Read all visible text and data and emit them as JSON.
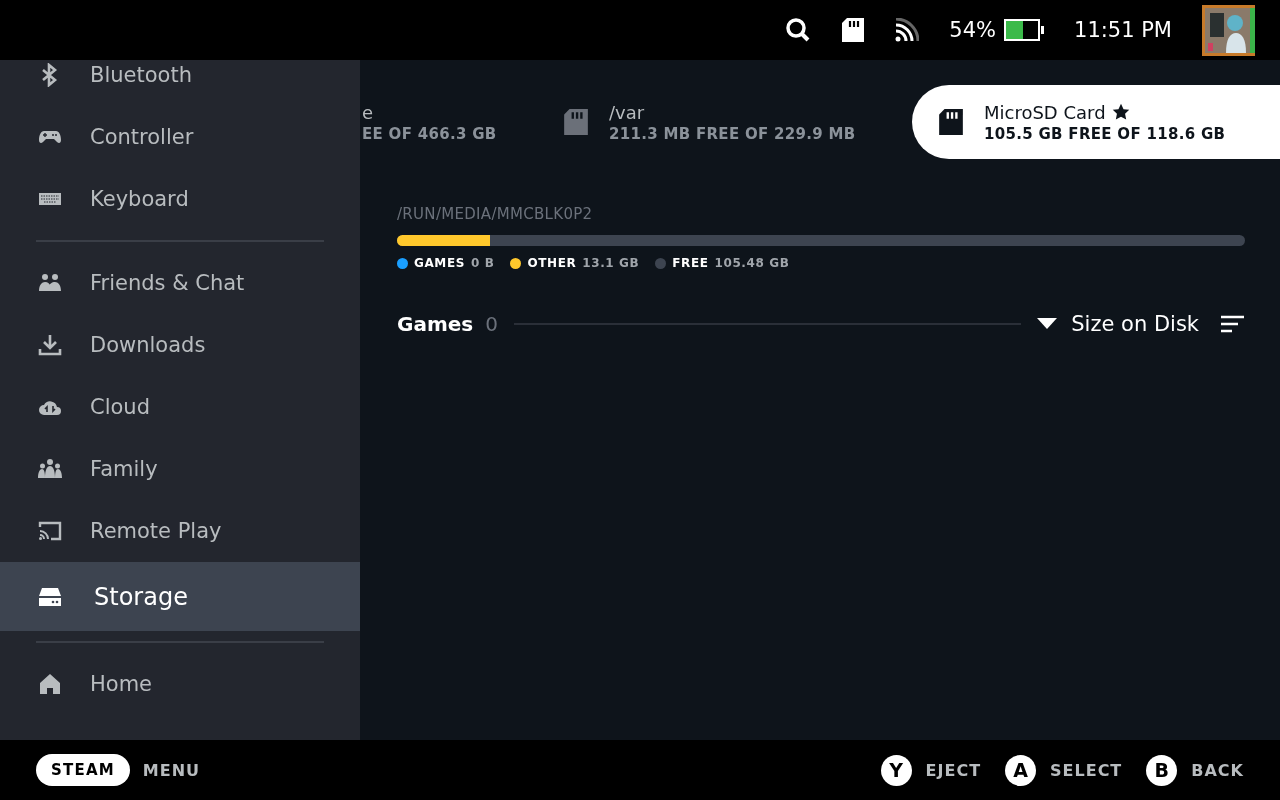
{
  "status_bar": {
    "battery": {
      "text": "54%",
      "level": 0.54
    },
    "time": "11:51 PM"
  },
  "sidebar": {
    "items": [
      {
        "kind": "item",
        "label": "Bluetooth",
        "selected": false
      },
      {
        "kind": "item",
        "label": "Controller",
        "selected": false
      },
      {
        "kind": "item",
        "label": "Keyboard",
        "selected": false
      },
      {
        "kind": "divider"
      },
      {
        "kind": "item",
        "label": "Friends & Chat",
        "selected": false
      },
      {
        "kind": "item",
        "label": "Downloads",
        "selected": false
      },
      {
        "kind": "item",
        "label": "Cloud",
        "selected": false
      },
      {
        "kind": "item",
        "label": "Family",
        "selected": false
      },
      {
        "kind": "item",
        "label": "Remote Play",
        "selected": false
      },
      {
        "kind": "item",
        "label": "Storage",
        "selected": true
      },
      {
        "kind": "divider"
      },
      {
        "kind": "item",
        "label": "Home",
        "selected": false
      }
    ]
  },
  "drives": [
    {
      "name": "e",
      "detail": "EE OF 466.3 GB",
      "selected": false,
      "starred": false,
      "icon": false
    },
    {
      "name": "/var",
      "detail": "211.3 MB FREE OF 229.9 MB",
      "selected": false,
      "starred": false,
      "icon": true
    },
    {
      "name": "MicroSD Card",
      "detail": "105.5 GB FREE OF 118.6 GB",
      "selected": true,
      "starred": true,
      "icon": true
    }
  ],
  "storage": {
    "path": "/RUN/MEDIA/MMCBLK0P2",
    "segments": [
      {
        "level": 0
      },
      {
        "level": 0.11
      }
    ],
    "legend": [
      {
        "label": "GAMES",
        "value": "0 B",
        "color": "#1a9fff"
      },
      {
        "label": "OTHER",
        "value": "13.1 GB",
        "color": "#ffc82c"
      },
      {
        "label": "FREE",
        "value": "105.48 GB",
        "color": "#3d4450"
      }
    ]
  },
  "games": {
    "title": "Games",
    "count": "0",
    "sort": "Size on Disk"
  },
  "footer": {
    "steam": "STEAM",
    "menu": "MENU",
    "actions": [
      {
        "key": "Y",
        "label": "EJECT"
      },
      {
        "key": "A",
        "label": "SELECT"
      },
      {
        "key": "B",
        "label": "BACK"
      }
    ]
  }
}
